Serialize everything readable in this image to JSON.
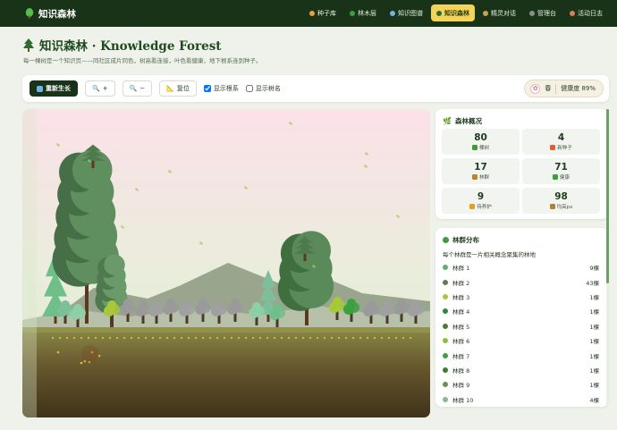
{
  "brand": {
    "name": "知识森林"
  },
  "nav": [
    {
      "label": "种子库",
      "icon": "seed-icon",
      "color": "#e6a13a",
      "active": false
    },
    {
      "label": "林木层",
      "icon": "tree-icon",
      "color": "#3e9b3e",
      "active": false
    },
    {
      "label": "知识图谱",
      "icon": "graph-icon",
      "color": "#6fb4e6",
      "active": false
    },
    {
      "label": "知识森林",
      "icon": "forest-icon",
      "color": "#2e6b2e",
      "active": true
    },
    {
      "label": "精灵对话",
      "icon": "sprite-icon",
      "color": "#c9a14a",
      "active": false
    },
    {
      "label": "管理台",
      "icon": "admin-icon",
      "color": "#8a8f86",
      "active": false
    },
    {
      "label": "活动日志",
      "icon": "log-icon",
      "color": "#e07a5a",
      "active": false
    }
  ],
  "page": {
    "title": "知识森林 · Knowledge Forest",
    "subtitle": "每一棵树是一个知识页——同社区成片同色，树高看连接，叶色看健康，地下根系连到种子。"
  },
  "toolbar": {
    "regrow": "重新生长",
    "zoom_in": "+",
    "zoom_out": "−",
    "reset": "复位",
    "show_roots": "显示根系",
    "show_roots_checked": true,
    "show_names": "显示树名",
    "show_names_checked": false,
    "season": "春",
    "health": "健康度 89%"
  },
  "overview": {
    "title": "森林概况",
    "stats": [
      {
        "value": "80",
        "label": "棵树",
        "icon": "tree-icon",
        "color": "#3e9b3e"
      },
      {
        "value": "4",
        "label": "新种子",
        "icon": "seed-icon",
        "color": "#e06030"
      },
      {
        "value": "17",
        "label": "林群",
        "icon": "grove-icon",
        "color": "#b8862e"
      },
      {
        "value": "71",
        "label": "健康",
        "icon": "check-icon",
        "color": "#3aa03a"
      },
      {
        "value": "9",
        "label": "待养护",
        "icon": "warning-icon",
        "color": "#e0a020"
      },
      {
        "value": "98",
        "label": "均高px",
        "icon": "ruler-icon",
        "color": "#b08040"
      }
    ]
  },
  "clusters": {
    "title": "林群分布",
    "description": "每个林群是一片相关概念聚集的林地",
    "items": [
      {
        "name": "林群 1",
        "count": "9棵",
        "color": "#5fae7a"
      },
      {
        "name": "林群 2",
        "count": "43棵",
        "color": "#5a7e4e"
      },
      {
        "name": "林群 3",
        "count": "1棵",
        "color": "#a8c83a"
      },
      {
        "name": "林群 4",
        "count": "1棵",
        "color": "#2e8a3a"
      },
      {
        "name": "林群 5",
        "count": "1棵",
        "color": "#4f7a30"
      },
      {
        "name": "林群 6",
        "count": "1棵",
        "color": "#8fbf3a"
      },
      {
        "name": "林群 7",
        "count": "1棵",
        "color": "#3aa040"
      },
      {
        "name": "林群 8",
        "count": "1棵",
        "color": "#3f7a2e"
      },
      {
        "name": "林群 9",
        "count": "1棵",
        "color": "#6e8e52"
      },
      {
        "name": "林群 10",
        "count": "4棵",
        "color": "#8ab88a"
      }
    ]
  }
}
